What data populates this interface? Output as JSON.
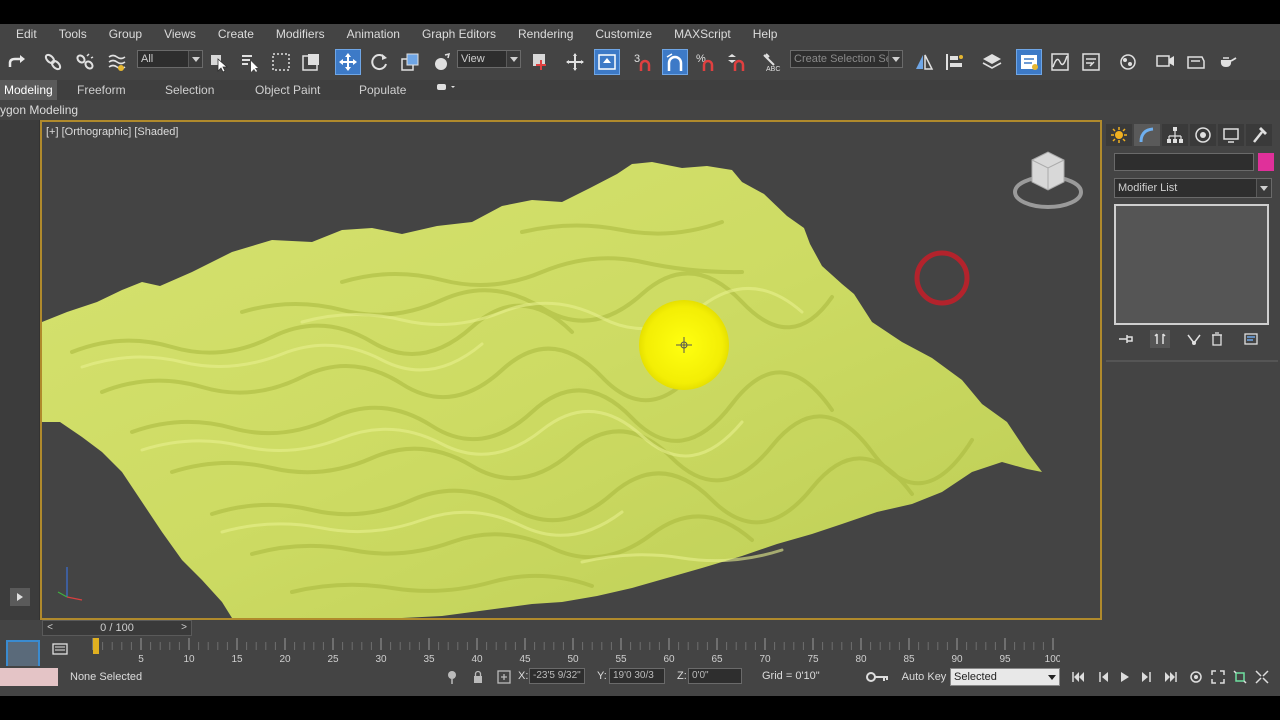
{
  "menu": [
    "Edit",
    "Tools",
    "Group",
    "Views",
    "Create",
    "Modifiers",
    "Animation",
    "Graph Editors",
    "Rendering",
    "Customize",
    "MAXScript",
    "Help"
  ],
  "toolbar": {
    "selection_filter": "All",
    "ref_coord": "View",
    "snap_label": "3",
    "named_selection_placeholder": "Create Selection Se"
  },
  "ribbon": {
    "tabs": [
      "Modeling",
      "Freeform",
      "Selection",
      "Object Paint",
      "Populate"
    ],
    "active_tab": "Modeling",
    "sub_label": "ygon Modeling"
  },
  "viewport": {
    "label": "[+] [Orthographic] [Shaded]",
    "surface_color": "#d2df6a",
    "background_color": "#444444",
    "border_color": "#b08a2c",
    "cursor_highlight_color": "#f5f000",
    "marker_ring_color": "#c0202a"
  },
  "command_panel": {
    "modifier_list": "Modifier List",
    "object_color": "#e0309a"
  },
  "timeline": {
    "time_display": "0 / 100",
    "frame_current": 0,
    "frame_end": 100,
    "ticks": [
      "5",
      "10",
      "15",
      "20",
      "25",
      "30",
      "35",
      "40",
      "45",
      "50",
      "55",
      "60",
      "65",
      "70",
      "75",
      "80",
      "85",
      "90",
      "95",
      "100"
    ]
  },
  "status": {
    "selection": "None Selected",
    "x_label": "X:",
    "x_value": "-23'5 9/32\"",
    "y_label": "Y:",
    "y_value": "19'0 30/3",
    "z_label": "Z:",
    "z_value": "0'0\"",
    "grid": "Grid = 0'10\"",
    "auto_key": "Auto Key",
    "key_filter": "Selected"
  }
}
